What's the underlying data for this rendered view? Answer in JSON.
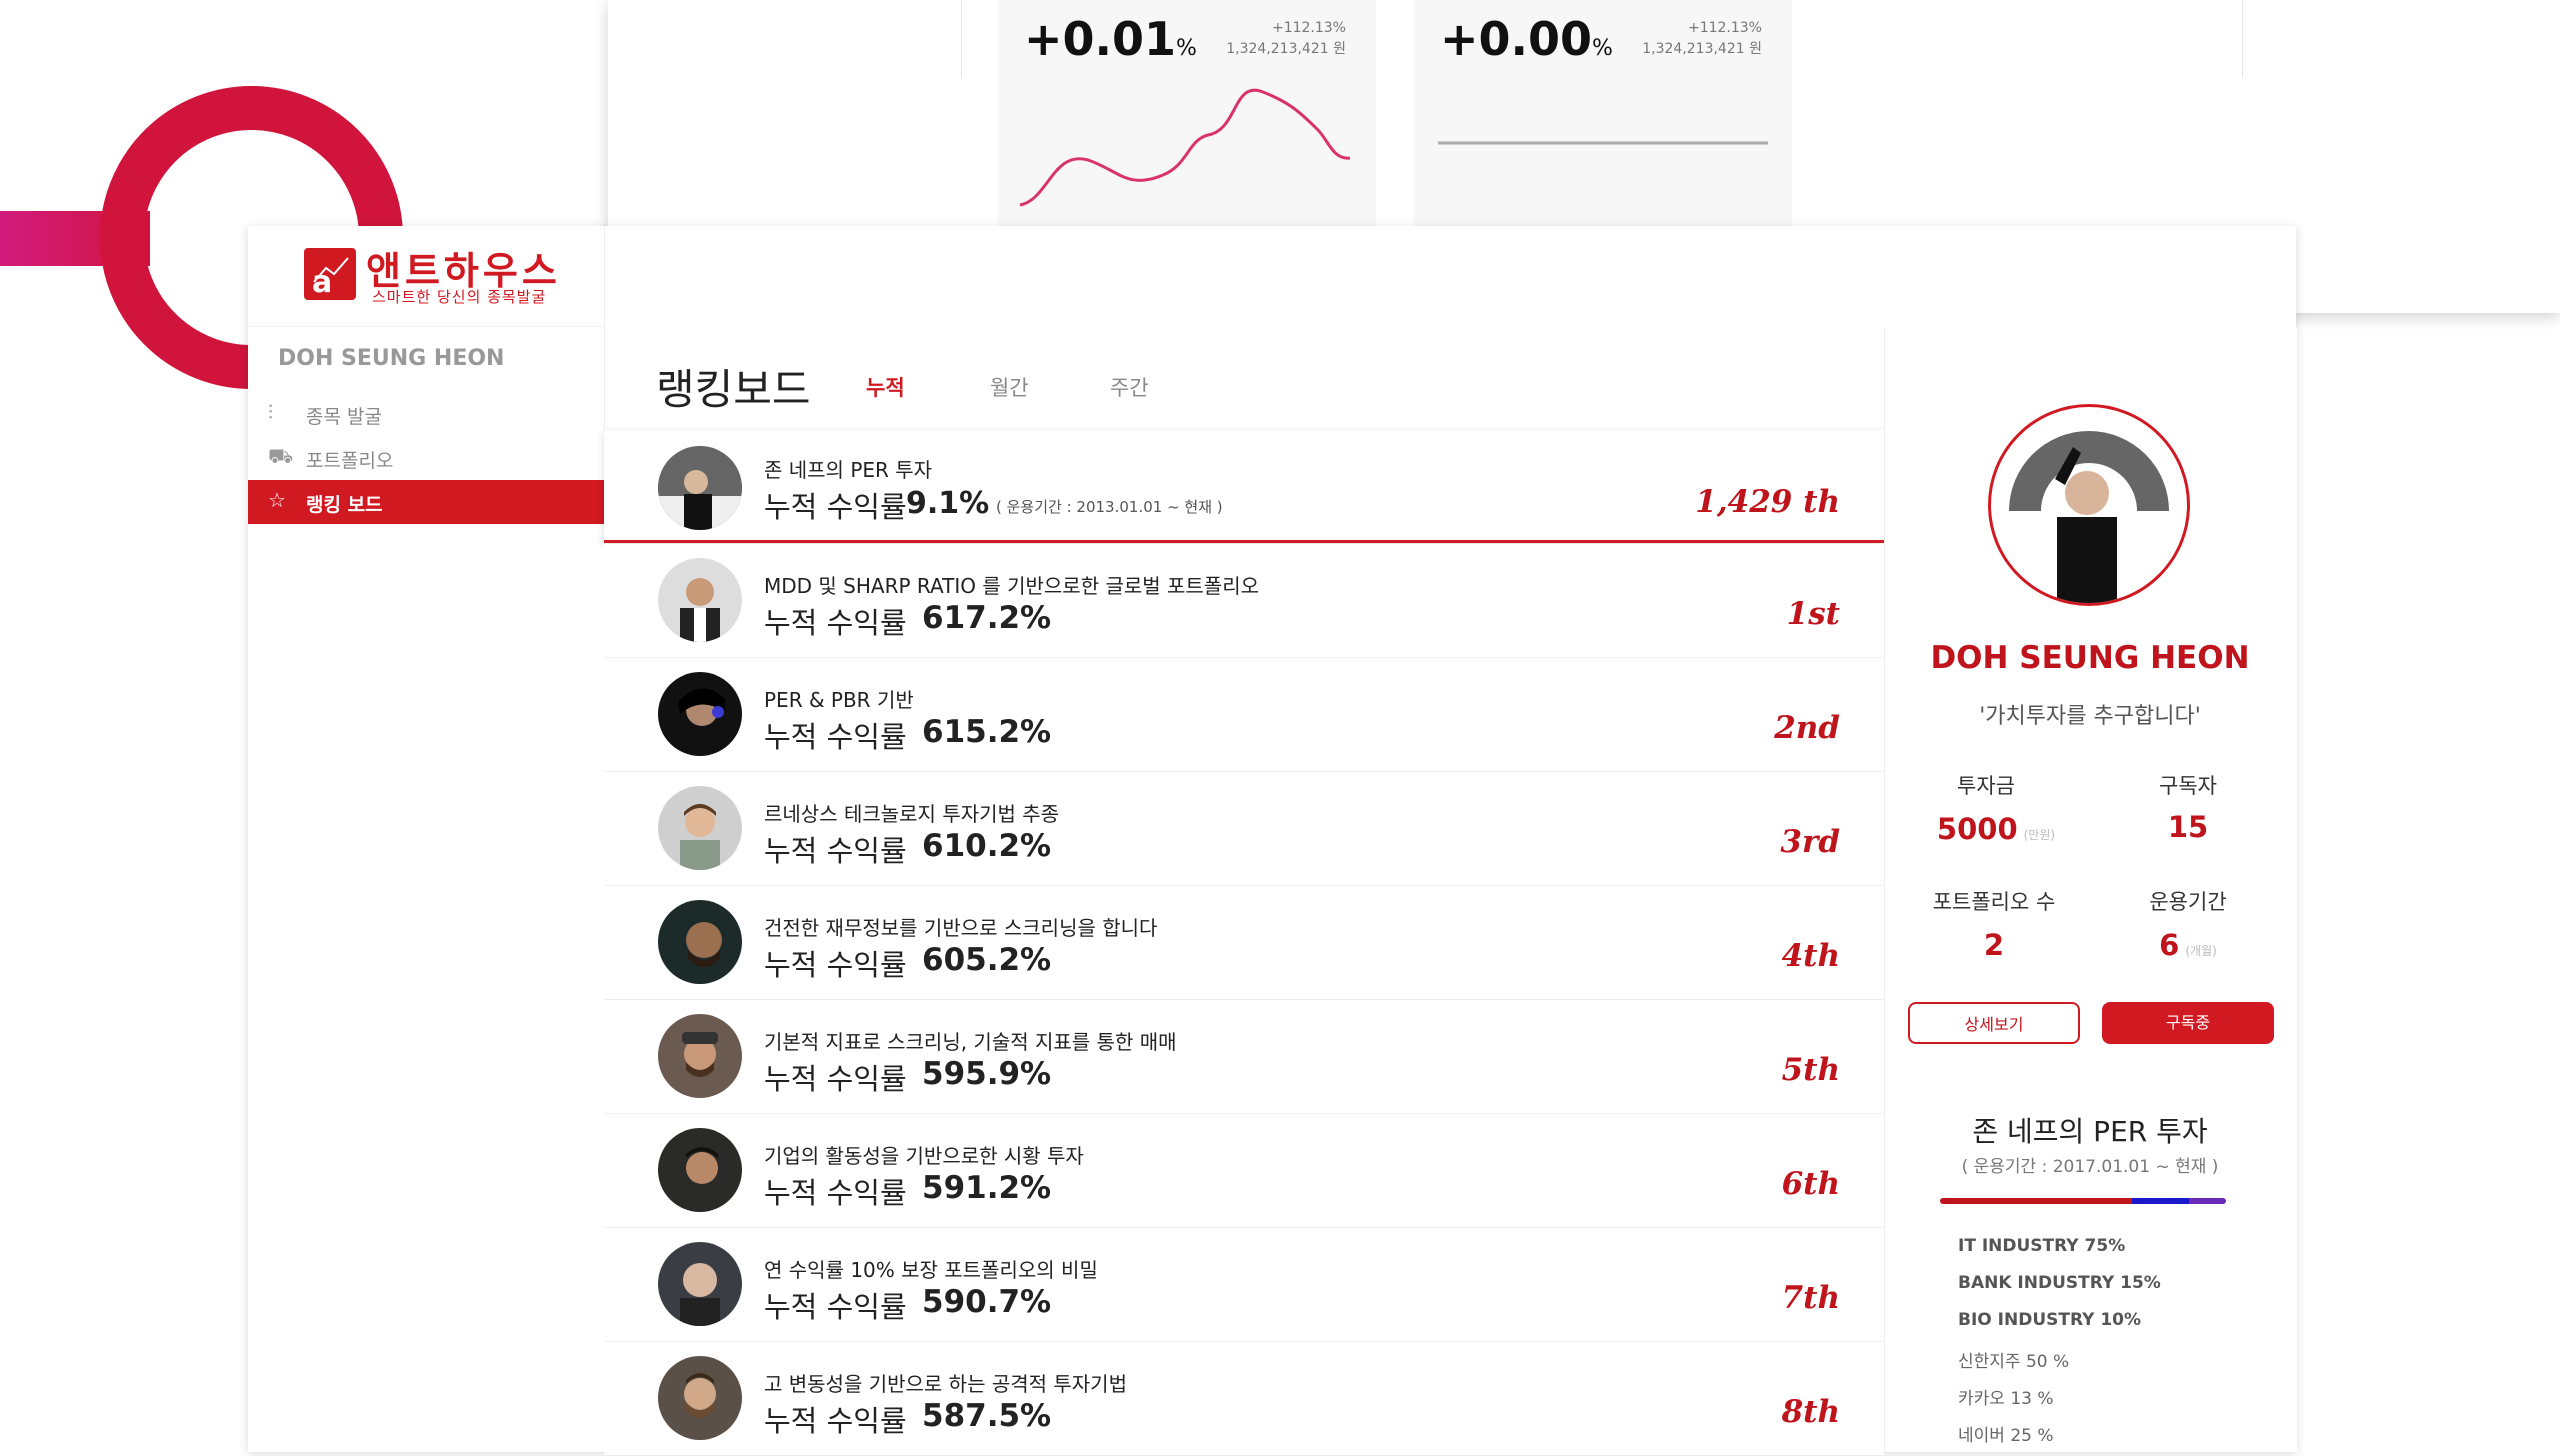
{
  "top_cards": [
    {
      "change": "+0.01",
      "unit": "%",
      "sub_pct": "+112.13%",
      "sub_amount": "1,324,213,421 원"
    },
    {
      "change": "+0.00",
      "unit": "%",
      "sub_pct": "+112.13%",
      "sub_amount": "1,324,213,421 원"
    }
  ],
  "brand": {
    "logo_letter": "a",
    "name": "앤트하우스",
    "tagline": "스마트한 당신의 종목발굴"
  },
  "sidebar": {
    "username": "DOH SEUNG HEON",
    "items": [
      {
        "label": "종목 발굴",
        "icon": "sliders-icon",
        "active": false
      },
      {
        "label": "포트폴리오",
        "icon": "cart-icon",
        "active": false
      },
      {
        "label": "랭킹 보드",
        "icon": "star-icon",
        "active": true
      }
    ]
  },
  "main": {
    "title": "랭킹보드",
    "tabs": [
      {
        "label": "누적",
        "active": true
      },
      {
        "label": "월간",
        "active": false
      },
      {
        "label": "주간",
        "active": false
      }
    ],
    "my_row": {
      "title": "존 네프의 PER 투자",
      "label": "누적 수익률",
      "value": "9.1%",
      "period": "( 운용기간 : 2013.01.01 ~ 현재 )",
      "rank": "1,429 th"
    },
    "rows": [
      {
        "title": "MDD 및 SHARP RATIO 를 기반으로한 글로벌 포트폴리오",
        "label": "누적 수익률",
        "value": "617.2%",
        "rank": "1st"
      },
      {
        "title": "PER & PBR 기반",
        "label": "누적 수익률",
        "value": "615.2%",
        "rank": "2nd"
      },
      {
        "title": "르네상스 테크놀로지 투자기법 추종",
        "label": "누적 수익률",
        "value": "610.2%",
        "rank": "3rd"
      },
      {
        "title": "건전한 재무정보를 기반으로 스크리닝을 합니다",
        "label": "누적 수익률",
        "value": "605.2%",
        "rank": "4th"
      },
      {
        "title": "기본적 지표로 스크리닝, 기술적 지표를 통한 매매",
        "label": "누적 수익률",
        "value": "595.9%",
        "rank": "5th"
      },
      {
        "title": "기업의 활동성을 기반으로한 시황 투자",
        "label": "누적 수익률",
        "value": "591.2%",
        "rank": "6th"
      },
      {
        "title": "연 수익률 10% 보장 포트폴리오의 비밀",
        "label": "누적 수익률",
        "value": "590.7%",
        "rank": "7th"
      },
      {
        "title": "고 변동성을 기반으로 하는 공격적 투자기법",
        "label": "누적 수익률",
        "value": "587.5%",
        "rank": "8th"
      }
    ]
  },
  "profile": {
    "name": "DOH SEUNG HEON",
    "quote": "'가치투자를 추구합니다'",
    "stats": {
      "investment_label": "투자금",
      "investment_value": "5000",
      "investment_unit": "(만원)",
      "subscribers_label": "구독자",
      "subscribers_value": "15",
      "portfolios_label": "포트폴리오 수",
      "portfolios_value": "2",
      "period_label": "운용기간",
      "period_value": "6",
      "period_unit": "(개월)"
    },
    "detail_button": "상세보기",
    "subscribe_button": "구독중",
    "portfolio": {
      "title": "존 네프의 PER 투자",
      "period": "( 운용기간 : 2017.01.01 ~ 현재 )",
      "allocation_colors": [
        "#c0141c",
        "#1a1acc",
        "#6a2ab8"
      ],
      "allocation": [
        0.67,
        0.2,
        0.13
      ],
      "items": [
        {
          "label": "IT INDUSTRY  75%",
          "bold": true
        },
        {
          "label": "BANK INDUSTRY 15%",
          "bold": true
        },
        {
          "label": "BIO INDUSTRY 10%",
          "bold": true
        },
        {
          "label": "신한지주 50 %",
          "bold": false
        },
        {
          "label": "카카오 13 %",
          "bold": false
        },
        {
          "label": "네이버 25 %",
          "bold": false
        }
      ]
    }
  }
}
